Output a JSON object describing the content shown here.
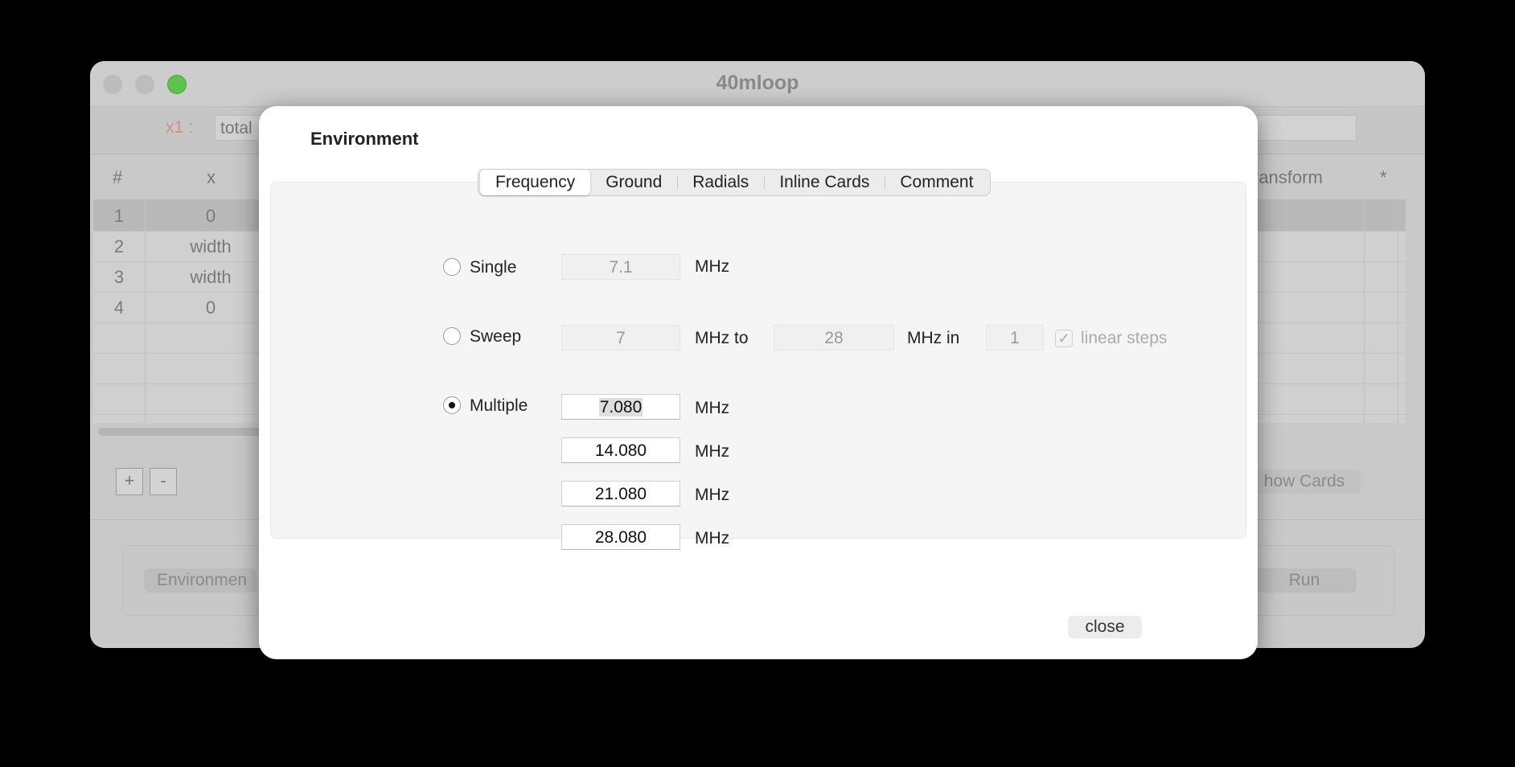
{
  "window": {
    "title": "40mloop"
  },
  "toolbar": {
    "x1_label": "x1 :",
    "x1_value": "total"
  },
  "table": {
    "headers": {
      "num": "#",
      "x": "x",
      "transform": "ransform",
      "star": "*"
    },
    "rows": [
      {
        "num": "1",
        "x": "0"
      },
      {
        "num": "2",
        "x": "width"
      },
      {
        "num": "3",
        "x": "width"
      },
      {
        "num": "4",
        "x": "0"
      }
    ]
  },
  "buttons": {
    "plus": "+",
    "minus": "-",
    "show_cards": "how Cards",
    "environment": "Environmen",
    "run": "Run"
  },
  "dialog": {
    "title": "Environment",
    "tabs": [
      "Frequency",
      "Ground",
      "Radials",
      "Inline Cards",
      "Comment"
    ],
    "active_tab": "Frequency",
    "single": {
      "label": "Single",
      "value": "7.1",
      "unit": "MHz",
      "selected": false
    },
    "sweep": {
      "label": "Sweep",
      "selected": false,
      "from": "7",
      "from_unit": "MHz to",
      "to": "28",
      "to_unit": "MHz in",
      "steps": "1",
      "linear_label": "linear steps",
      "linear_checked": true
    },
    "multiple": {
      "label": "Multiple",
      "selected": true,
      "unit": "MHz",
      "values": [
        "7.080",
        "14.080",
        "21.080",
        "28.080"
      ]
    },
    "close_label": "close"
  }
}
